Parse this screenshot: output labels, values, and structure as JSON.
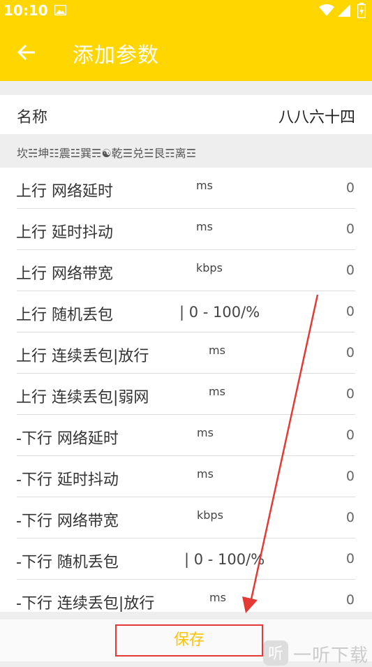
{
  "status_bar": {
    "time": "10:10"
  },
  "toolbar": {
    "title": "添加参数"
  },
  "name_row": {
    "label": "名称",
    "value": "八八六十四"
  },
  "section_header": "坎☵坤☷震☳巽☴☯乾☰兑☱艮☶离☲",
  "params": [
    {
      "label": "上行 网络延时",
      "unit": "ms",
      "value": "0"
    },
    {
      "label": "上行 延时抖动",
      "unit": "ms",
      "value": "0"
    },
    {
      "label": "上行 网络带宽",
      "unit": "kbps",
      "value": "0"
    },
    {
      "label": "上行 随机丢包",
      "unit": "| 0 - 100/%",
      "value": "0"
    },
    {
      "label": "上行 连续丢包|放行",
      "unit": "ms",
      "value": "0"
    },
    {
      "label": "上行 连续丢包|弱网",
      "unit": "ms",
      "value": "0"
    },
    {
      "label": "-下行 网络延时",
      "unit": "ms",
      "value": "0"
    },
    {
      "label": "-下行 延时抖动",
      "unit": "ms",
      "value": "0"
    },
    {
      "label": "-下行 网络带宽",
      "unit": "kbps",
      "value": "0"
    },
    {
      "label": "-下行 随机丢包",
      "unit": "| 0 - 100/%",
      "value": "0"
    },
    {
      "label": "-下行 连续丢包|放行",
      "unit": "ms",
      "value": "0"
    }
  ],
  "save_label": "保存",
  "watermark_text": "一听下载",
  "colors": {
    "accent": "#ffd600",
    "annotation": "#e53935",
    "save_text": "#ffc400"
  }
}
